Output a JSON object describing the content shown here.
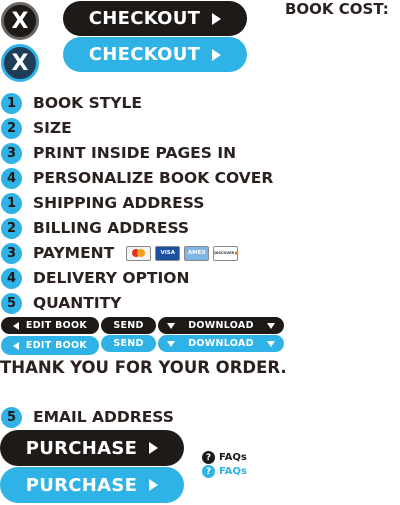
{
  "header": {
    "close_dark_label": "X",
    "close_blue_label": "X",
    "checkout_dark_label": "CHECKOUT",
    "checkout_blue_label": "CHECKOUT",
    "book_cost_label": "BOOK COST:"
  },
  "steps": [
    {
      "num": "1",
      "label": "BOOK STYLE"
    },
    {
      "num": "2",
      "label": "SIZE"
    },
    {
      "num": "3",
      "label": "PRINT INSIDE PAGES IN"
    },
    {
      "num": "4",
      "label": "PERSONALIZE BOOK COVER"
    },
    {
      "num": "1",
      "label": "SHIPPING ADDRESS"
    },
    {
      "num": "2",
      "label": "BILLING ADDRESS"
    },
    {
      "num": "3",
      "label": "PAYMENT"
    },
    {
      "num": "4",
      "label": "DELIVERY OPTION"
    },
    {
      "num": "5",
      "label": "QUANTITY"
    }
  ],
  "payment_cards": {
    "mastercard": "",
    "visa": "VISA",
    "amex": "AMEX",
    "discover": "DISCOVER"
  },
  "actions_dark": {
    "edit_book": "EDIT BOOK",
    "send": "SEND",
    "download": "DOWNLOAD"
  },
  "actions_blue": {
    "edit_book": "EDIT BOOK",
    "send": "SEND",
    "download": "DOWNLOAD"
  },
  "thank_you": "THANK YOU FOR YOUR ORDER.",
  "email_step": {
    "num": "5",
    "label": "EMAIL ADDRESS"
  },
  "purchase_dark_label": "PURCHASE",
  "purchase_blue_label": "PURCHASE",
  "faq_dark": {
    "icon": "?",
    "label": "FAQs"
  },
  "faq_blue": {
    "icon": "?",
    "label": "FAQs"
  },
  "colors": {
    "accent": "#2fb3e6",
    "dark": "#1e1a18",
    "text": "#2b2220"
  }
}
